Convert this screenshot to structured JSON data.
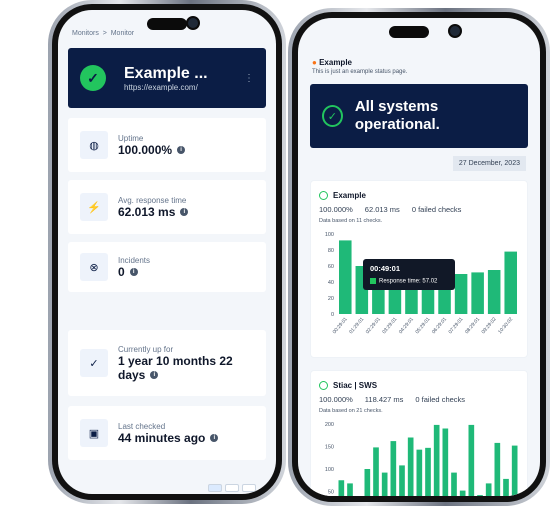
{
  "left_phone": {
    "breadcrumb": [
      "Monitors",
      "Monitor"
    ],
    "monitor": {
      "name": "Example ...",
      "url": "https://example.com/",
      "status_icon": "check-circle-icon"
    },
    "stats": [
      {
        "icon": "globe-icon",
        "label": "Uptime",
        "value": "100.000%"
      },
      {
        "icon": "bolt-icon",
        "label": "Avg. response time",
        "value": "62.013 ms"
      },
      {
        "icon": "x-circle-icon",
        "label": "Incidents",
        "value": "0"
      },
      {
        "icon": "check-icon",
        "label": "Currently up for",
        "value": "1 year 10 months 22 days"
      },
      {
        "icon": "calendar-check-icon",
        "label": "Last checked",
        "value": "44 minutes ago"
      }
    ]
  },
  "right_phone": {
    "page_title": "Example",
    "page_subtitle": "This is just an example status page.",
    "overall_status": "All systems operational.",
    "date": "27 December, 2023",
    "monitors": [
      {
        "name": "Example",
        "uptime": "100.000%",
        "avg": "62.013 ms",
        "failed": "0 failed checks",
        "based_on": "Data based on 11 checks.",
        "tooltip": {
          "time": "00:49:01",
          "text": "Response time: 57.02"
        }
      },
      {
        "name": "Stiac | SWS",
        "uptime": "100.000%",
        "avg": "118.427 ms",
        "failed": "0 failed checks",
        "based_on": "Data based on 21 checks."
      }
    ]
  },
  "colors": {
    "navy": "#0b1d45",
    "green": "#22c55e",
    "bar": "#1fb978"
  },
  "chart_data": [
    {
      "type": "bar",
      "categories": [
        "00:29:01",
        "01:29:01",
        "02:29:01",
        "03:29:01",
        "04:29:01",
        "05:29:01",
        "06:29:01",
        "07:29:01",
        "08:29:01",
        "09:29:02",
        "10:30:02"
      ],
      "values": [
        92,
        60,
        52,
        45,
        48,
        50,
        52,
        50,
        52,
        55,
        78
      ],
      "ylim": [
        0,
        100
      ],
      "yticks": [
        0,
        20,
        40,
        60,
        80,
        100
      ]
    },
    {
      "type": "bar",
      "values": [
        75,
        68,
        30,
        100,
        148,
        92,
        162,
        108,
        170,
        143,
        147,
        198,
        190,
        92,
        52,
        198,
        42,
        68,
        158,
        78,
        152
      ],
      "ylim": [
        0,
        200
      ],
      "yticks": [
        50,
        100,
        150,
        200
      ]
    }
  ]
}
